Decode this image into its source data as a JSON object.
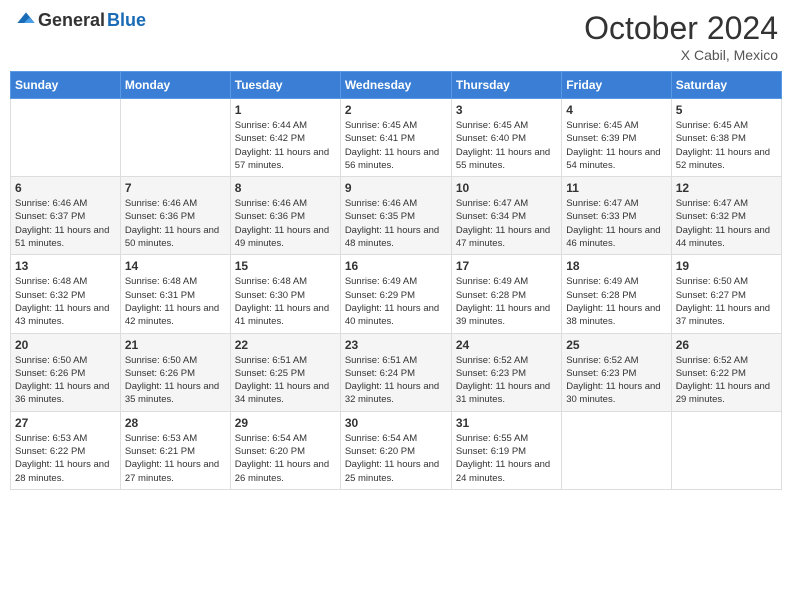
{
  "header": {
    "logo_general": "General",
    "logo_blue": "Blue",
    "month": "October 2024",
    "location": "X Cabil, Mexico"
  },
  "days_of_week": [
    "Sunday",
    "Monday",
    "Tuesday",
    "Wednesday",
    "Thursday",
    "Friday",
    "Saturday"
  ],
  "weeks": [
    [
      {
        "day": "",
        "content": ""
      },
      {
        "day": "",
        "content": ""
      },
      {
        "day": "1",
        "content": "Sunrise: 6:44 AM\nSunset: 6:42 PM\nDaylight: 11 hours and 57 minutes."
      },
      {
        "day": "2",
        "content": "Sunrise: 6:45 AM\nSunset: 6:41 PM\nDaylight: 11 hours and 56 minutes."
      },
      {
        "day": "3",
        "content": "Sunrise: 6:45 AM\nSunset: 6:40 PM\nDaylight: 11 hours and 55 minutes."
      },
      {
        "day": "4",
        "content": "Sunrise: 6:45 AM\nSunset: 6:39 PM\nDaylight: 11 hours and 54 minutes."
      },
      {
        "day": "5",
        "content": "Sunrise: 6:45 AM\nSunset: 6:38 PM\nDaylight: 11 hours and 52 minutes."
      }
    ],
    [
      {
        "day": "6",
        "content": "Sunrise: 6:46 AM\nSunset: 6:37 PM\nDaylight: 11 hours and 51 minutes."
      },
      {
        "day": "7",
        "content": "Sunrise: 6:46 AM\nSunset: 6:36 PM\nDaylight: 11 hours and 50 minutes."
      },
      {
        "day": "8",
        "content": "Sunrise: 6:46 AM\nSunset: 6:36 PM\nDaylight: 11 hours and 49 minutes."
      },
      {
        "day": "9",
        "content": "Sunrise: 6:46 AM\nSunset: 6:35 PM\nDaylight: 11 hours and 48 minutes."
      },
      {
        "day": "10",
        "content": "Sunrise: 6:47 AM\nSunset: 6:34 PM\nDaylight: 11 hours and 47 minutes."
      },
      {
        "day": "11",
        "content": "Sunrise: 6:47 AM\nSunset: 6:33 PM\nDaylight: 11 hours and 46 minutes."
      },
      {
        "day": "12",
        "content": "Sunrise: 6:47 AM\nSunset: 6:32 PM\nDaylight: 11 hours and 44 minutes."
      }
    ],
    [
      {
        "day": "13",
        "content": "Sunrise: 6:48 AM\nSunset: 6:32 PM\nDaylight: 11 hours and 43 minutes."
      },
      {
        "day": "14",
        "content": "Sunrise: 6:48 AM\nSunset: 6:31 PM\nDaylight: 11 hours and 42 minutes."
      },
      {
        "day": "15",
        "content": "Sunrise: 6:48 AM\nSunset: 6:30 PM\nDaylight: 11 hours and 41 minutes."
      },
      {
        "day": "16",
        "content": "Sunrise: 6:49 AM\nSunset: 6:29 PM\nDaylight: 11 hours and 40 minutes."
      },
      {
        "day": "17",
        "content": "Sunrise: 6:49 AM\nSunset: 6:28 PM\nDaylight: 11 hours and 39 minutes."
      },
      {
        "day": "18",
        "content": "Sunrise: 6:49 AM\nSunset: 6:28 PM\nDaylight: 11 hours and 38 minutes."
      },
      {
        "day": "19",
        "content": "Sunrise: 6:50 AM\nSunset: 6:27 PM\nDaylight: 11 hours and 37 minutes."
      }
    ],
    [
      {
        "day": "20",
        "content": "Sunrise: 6:50 AM\nSunset: 6:26 PM\nDaylight: 11 hours and 36 minutes."
      },
      {
        "day": "21",
        "content": "Sunrise: 6:50 AM\nSunset: 6:26 PM\nDaylight: 11 hours and 35 minutes."
      },
      {
        "day": "22",
        "content": "Sunrise: 6:51 AM\nSunset: 6:25 PM\nDaylight: 11 hours and 34 minutes."
      },
      {
        "day": "23",
        "content": "Sunrise: 6:51 AM\nSunset: 6:24 PM\nDaylight: 11 hours and 32 minutes."
      },
      {
        "day": "24",
        "content": "Sunrise: 6:52 AM\nSunset: 6:23 PM\nDaylight: 11 hours and 31 minutes."
      },
      {
        "day": "25",
        "content": "Sunrise: 6:52 AM\nSunset: 6:23 PM\nDaylight: 11 hours and 30 minutes."
      },
      {
        "day": "26",
        "content": "Sunrise: 6:52 AM\nSunset: 6:22 PM\nDaylight: 11 hours and 29 minutes."
      }
    ],
    [
      {
        "day": "27",
        "content": "Sunrise: 6:53 AM\nSunset: 6:22 PM\nDaylight: 11 hours and 28 minutes."
      },
      {
        "day": "28",
        "content": "Sunrise: 6:53 AM\nSunset: 6:21 PM\nDaylight: 11 hours and 27 minutes."
      },
      {
        "day": "29",
        "content": "Sunrise: 6:54 AM\nSunset: 6:20 PM\nDaylight: 11 hours and 26 minutes."
      },
      {
        "day": "30",
        "content": "Sunrise: 6:54 AM\nSunset: 6:20 PM\nDaylight: 11 hours and 25 minutes."
      },
      {
        "day": "31",
        "content": "Sunrise: 6:55 AM\nSunset: 6:19 PM\nDaylight: 11 hours and 24 minutes."
      },
      {
        "day": "",
        "content": ""
      },
      {
        "day": "",
        "content": ""
      }
    ]
  ]
}
